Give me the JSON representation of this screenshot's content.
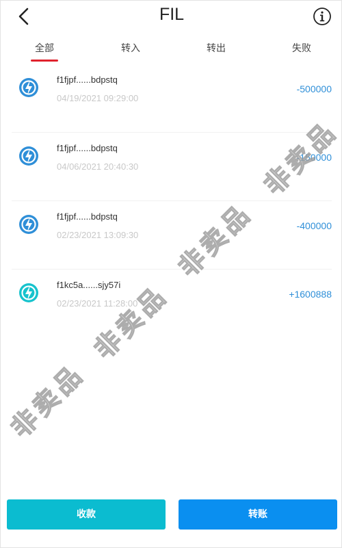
{
  "header": {
    "title": "FIL",
    "back_icon": "chevron-left-icon",
    "info_icon": "info-icon"
  },
  "tabs": [
    {
      "label": "全部",
      "active": true
    },
    {
      "label": "转入",
      "active": false
    },
    {
      "label": "转出",
      "active": false
    },
    {
      "label": "失败",
      "active": false
    }
  ],
  "transactions": [
    {
      "address": "f1fjpf......bdpstq",
      "time": "04/19/2021 09:29:00",
      "amount": "-500000",
      "icon": "send-arrow-icon",
      "icon_color": "#2f8fd8"
    },
    {
      "address": "f1fjpf......bdpstq",
      "time": "04/06/2021 20:40:30",
      "amount": "-150000",
      "icon": "send-arrow-icon",
      "icon_color": "#2f8fd8"
    },
    {
      "address": "f1fjpf......bdpstq",
      "time": "02/23/2021 13:09:30",
      "amount": "-400000",
      "icon": "send-arrow-icon",
      "icon_color": "#2f8fd8"
    },
    {
      "address": "f1kc5a......sjy57i",
      "time": "02/23/2021 11:28:00",
      "amount": "+1600888",
      "icon": "receive-arrow-icon",
      "icon_color": "#17c3cd"
    }
  ],
  "watermark": "非卖品",
  "buttons": {
    "receive_label": "收款",
    "transfer_label": "转账"
  },
  "colors": {
    "accent_red": "#e0222d",
    "amount_blue": "#2f8fd8",
    "receive_button": "#0bbcd0",
    "transfer_button": "#0a8ff0"
  }
}
